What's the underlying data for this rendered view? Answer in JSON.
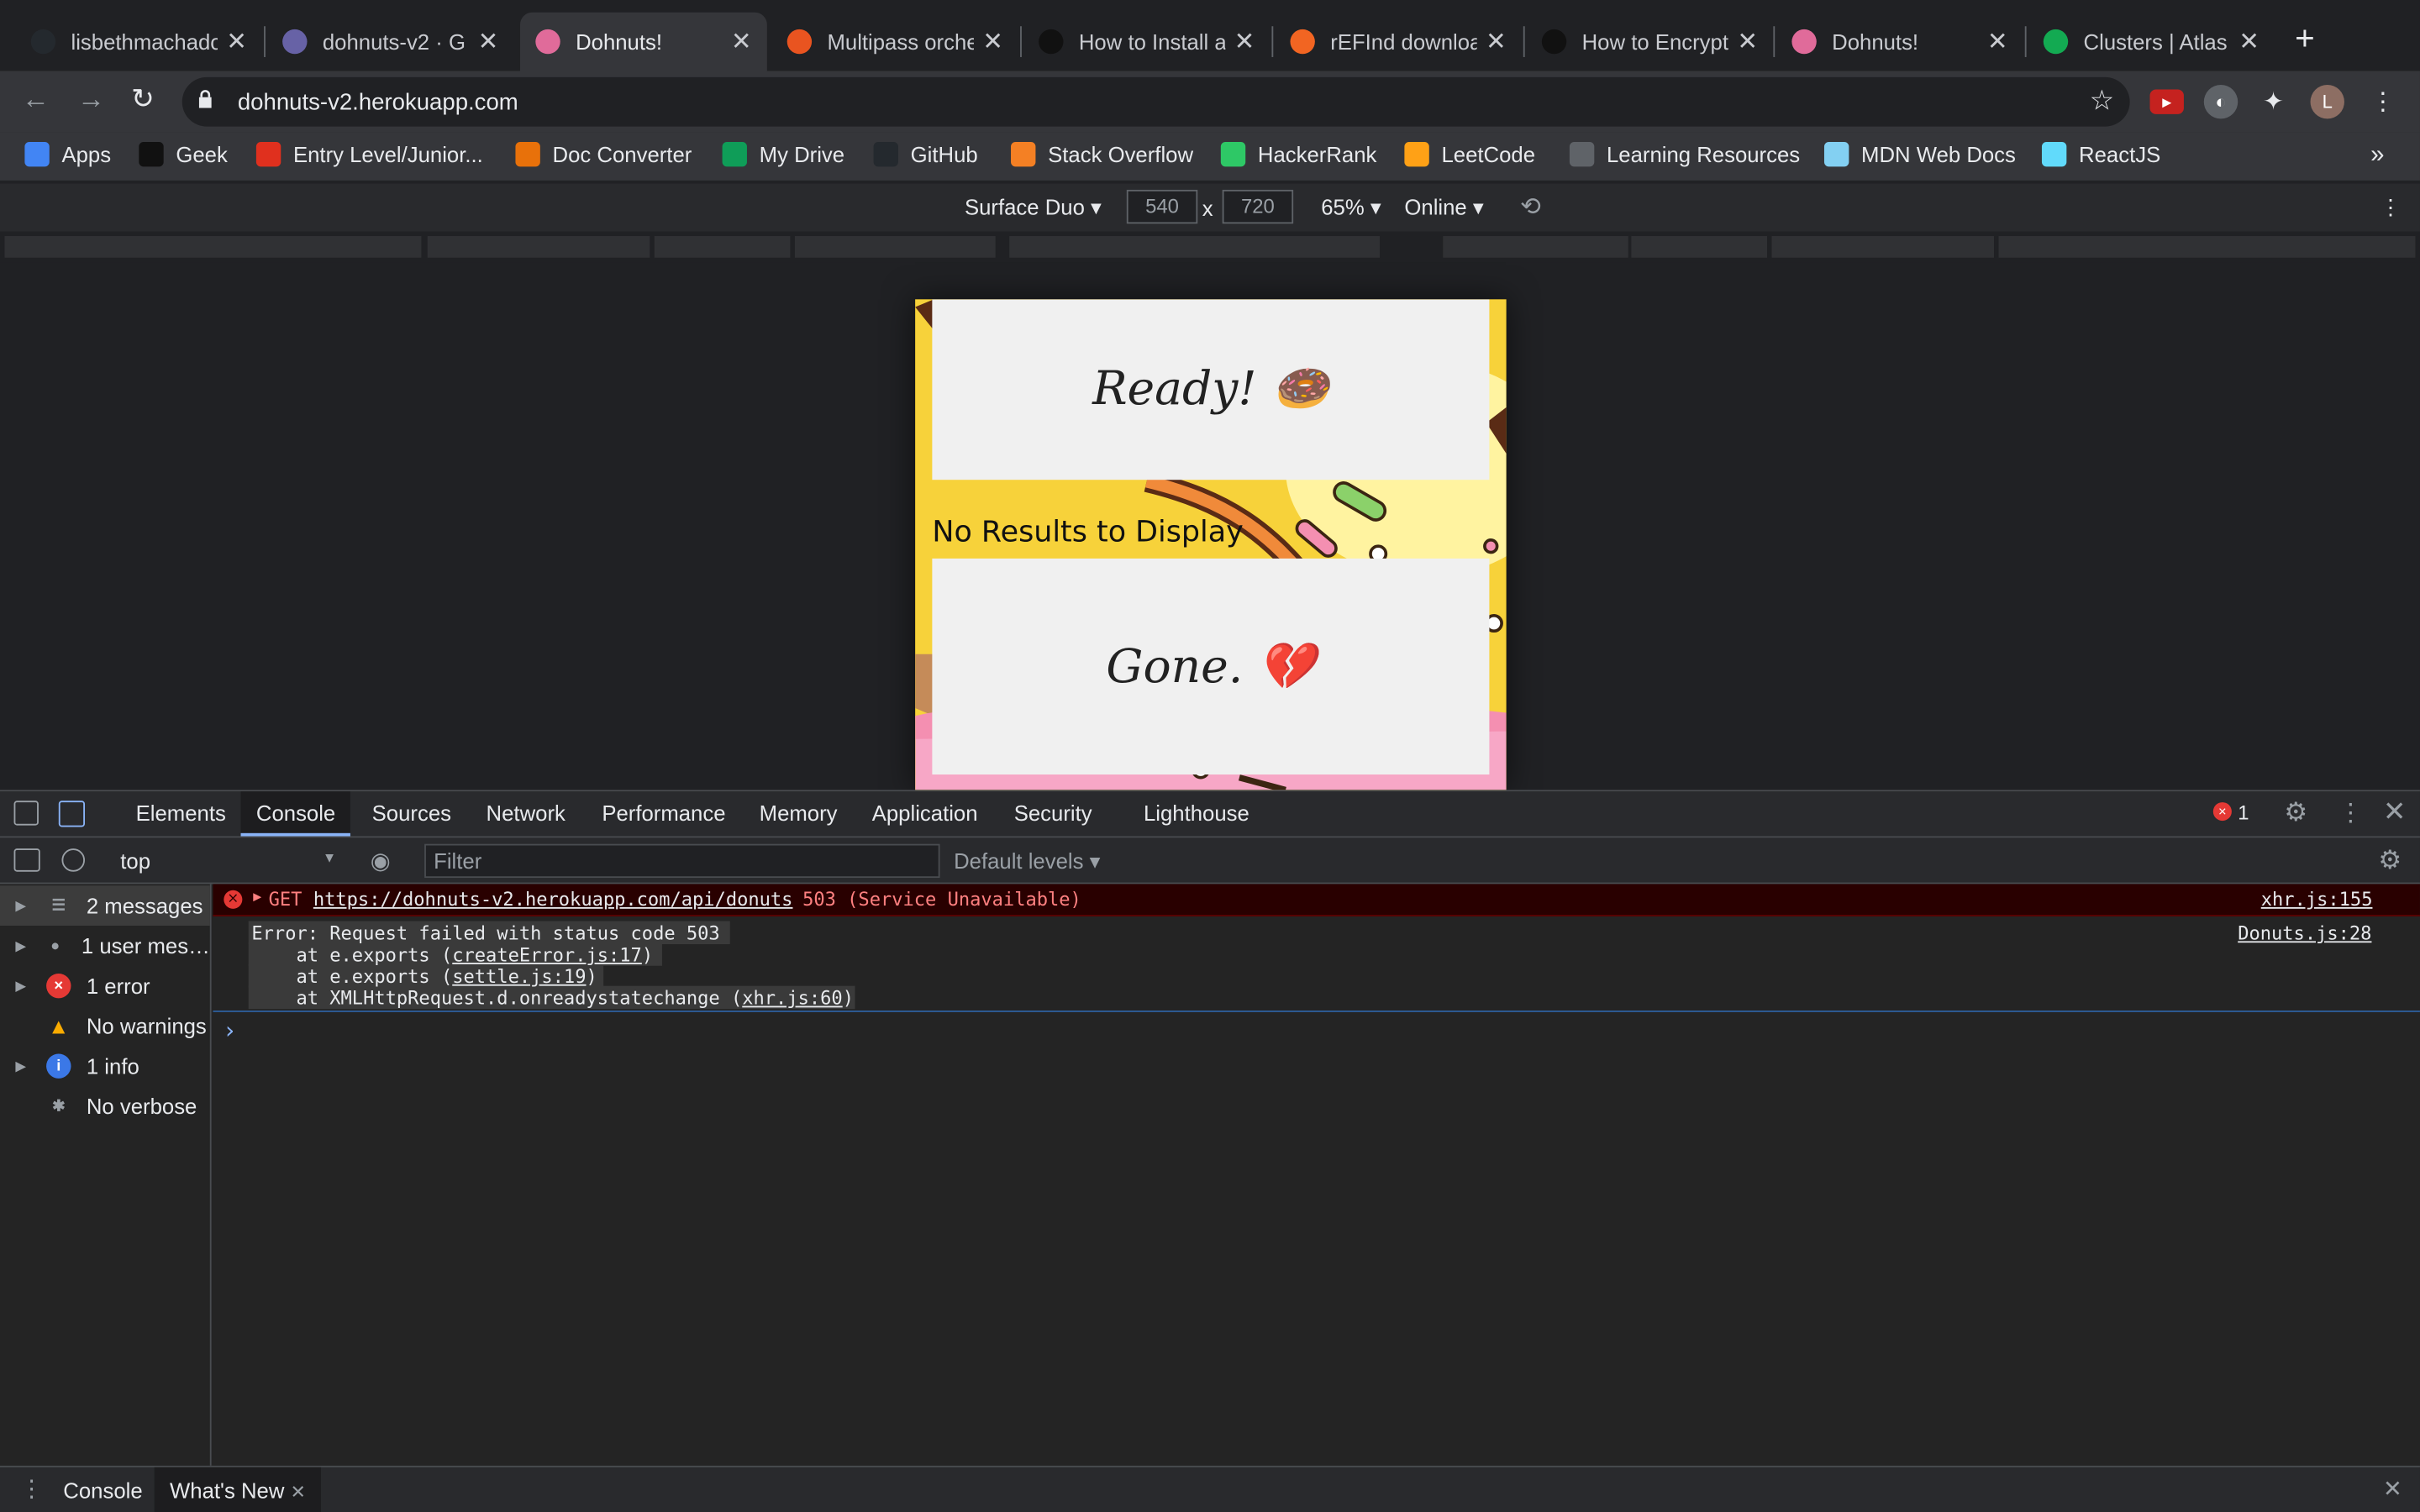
{
  "browser": {
    "tabs": [
      {
        "title": "lisbethmachado",
        "favicon": "github-icon",
        "color": "#24292e"
      },
      {
        "title": "dohnuts-v2 · G",
        "favicon": "heroku-icon",
        "color": "#6762a6"
      },
      {
        "title": "Dohnuts!",
        "favicon": "donut-icon",
        "color": "#e06b9a",
        "active": true
      },
      {
        "title": "Multipass orche",
        "favicon": "multipass-icon",
        "color": "#e95420"
      },
      {
        "title": "How to Install a",
        "favicon": "htg-icon",
        "color": "#111111"
      },
      {
        "title": "rEFInd downloa",
        "favicon": "sourceforge-icon",
        "color": "#f26522"
      },
      {
        "title": "How to Encrypt",
        "favicon": "htg-icon",
        "color": "#111111"
      },
      {
        "title": "Dohnuts!",
        "favicon": "donut-icon",
        "color": "#e06b9a"
      },
      {
        "title": "Clusters | Atlas",
        "favicon": "mongodb-leaf-icon",
        "color": "#13aa52"
      }
    ],
    "new_tab": "+",
    "url": "dohnuts-v2.herokuapp.com",
    "profile_initial": "L",
    "bookmarks": [
      {
        "label": "Apps",
        "icon": "apps-grid-icon",
        "color": "#4285f4"
      },
      {
        "label": "Geek",
        "icon": "htg-icon",
        "color": "#111111"
      },
      {
        "label": "Entry Level/Junior...",
        "icon": "builtin-icon",
        "color": "#e0301e"
      },
      {
        "label": "Doc Converter",
        "icon": "doc-converter-icon",
        "color": "#e8710a"
      },
      {
        "label": "My Drive",
        "icon": "google-drive-icon",
        "color": "#0f9d58"
      },
      {
        "label": "GitHub",
        "icon": "github-icon",
        "color": "#24292e"
      },
      {
        "label": "Stack Overflow",
        "icon": "stackoverflow-icon",
        "color": "#f48024"
      },
      {
        "label": "HackerRank",
        "icon": "hackerrank-icon",
        "color": "#2ec866"
      },
      {
        "label": "LeetCode",
        "icon": "leetcode-icon",
        "color": "#ffa116"
      },
      {
        "label": "Learning Resources",
        "icon": "globe-icon",
        "color": "#5f6368"
      },
      {
        "label": "MDN Web Docs",
        "icon": "mdn-icon",
        "color": "#83d0f2"
      },
      {
        "label": "ReactJS",
        "icon": "react-icon",
        "color": "#61dafb"
      }
    ],
    "bookmarks_more": "»"
  },
  "device_toolbar": {
    "device": "Surface Duo",
    "width": "540",
    "height": "720",
    "times": "x",
    "zoom": "65%",
    "network": "Online"
  },
  "page": {
    "card1_text": "Ready! 🍩",
    "no_results": "No Results to Display",
    "card2_text": "Gone. 💔"
  },
  "devtools": {
    "tabs": [
      "Elements",
      "Console",
      "Sources",
      "Network",
      "Performance",
      "Memory",
      "Application",
      "Security",
      "Lighthouse"
    ],
    "active_tab": "Console",
    "error_count": "1",
    "context": "top",
    "filter_placeholder": "Filter",
    "levels": "Default levels",
    "sidebar": [
      {
        "label": "2 messages",
        "icon": "list-icon",
        "color": "#5f6368"
      },
      {
        "label": "1 user mes…",
        "icon": "user-icon",
        "color": "#5f6368"
      },
      {
        "label": "1 error",
        "icon": "error-icon",
        "color": "#e53935"
      },
      {
        "label": "No warnings",
        "icon": "warning-icon",
        "color": "#f9ab00"
      },
      {
        "label": "1 info",
        "icon": "info-icon",
        "color": "#3b78e7"
      },
      {
        "label": "No verbose",
        "icon": "bug-icon",
        "color": "#5f6368"
      }
    ],
    "console": {
      "error_prefix": "GET",
      "error_url": "https://dohnuts-v2.herokuapp.com/api/donuts",
      "error_status": "503 (Service Unavailable)",
      "error_source": "xhr.js:155",
      "stack_line1": "Error: Request failed with status code 503",
      "stack_line2_prefix": "    at e.exports (",
      "stack_line2_link": "createError.js:17",
      "stack_line3_prefix": "    at e.exports (",
      "stack_line3_link": "settle.js:19",
      "stack_line4_prefix": "    at XMLHttpRequest.d.onreadystatechange (",
      "stack_line4_link": "xhr.js:60",
      "close_paren": ")",
      "stack_source": "Donuts.js:28",
      "prompt": "›"
    },
    "drawer_tabs": [
      "Console",
      "What's New"
    ]
  }
}
